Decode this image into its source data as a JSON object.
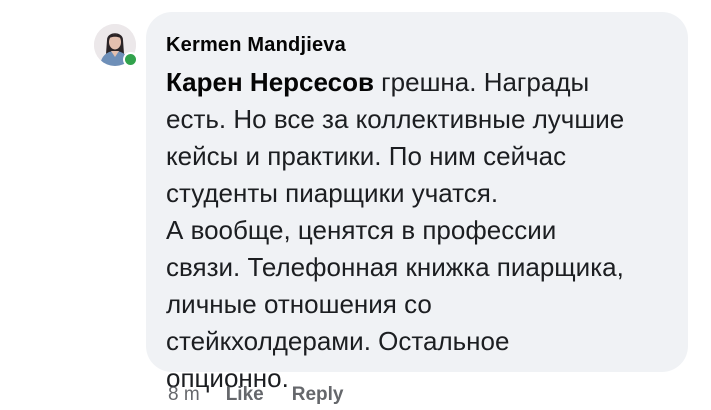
{
  "comment": {
    "avatar_icon": "profile-photo",
    "online_color": "#31a24c",
    "author": "Kermen Mandjieva",
    "mention": "Карен Нерсесов",
    "first_line_rest": " грешна. Награды",
    "lines": [
      "есть. Но все за коллективные лучшие",
      "кейсы и практики. По ним сейчас",
      "студенты пиарщики учатся.",
      "А вообще, ценятся в профессии",
      "связи. Телефонная книжка пиарщика,",
      "личные отношения со",
      "стейкхолдерами. Остальное",
      "опционно."
    ],
    "time": "8 m",
    "like_label": "Like",
    "reply_label": "Reply"
  }
}
